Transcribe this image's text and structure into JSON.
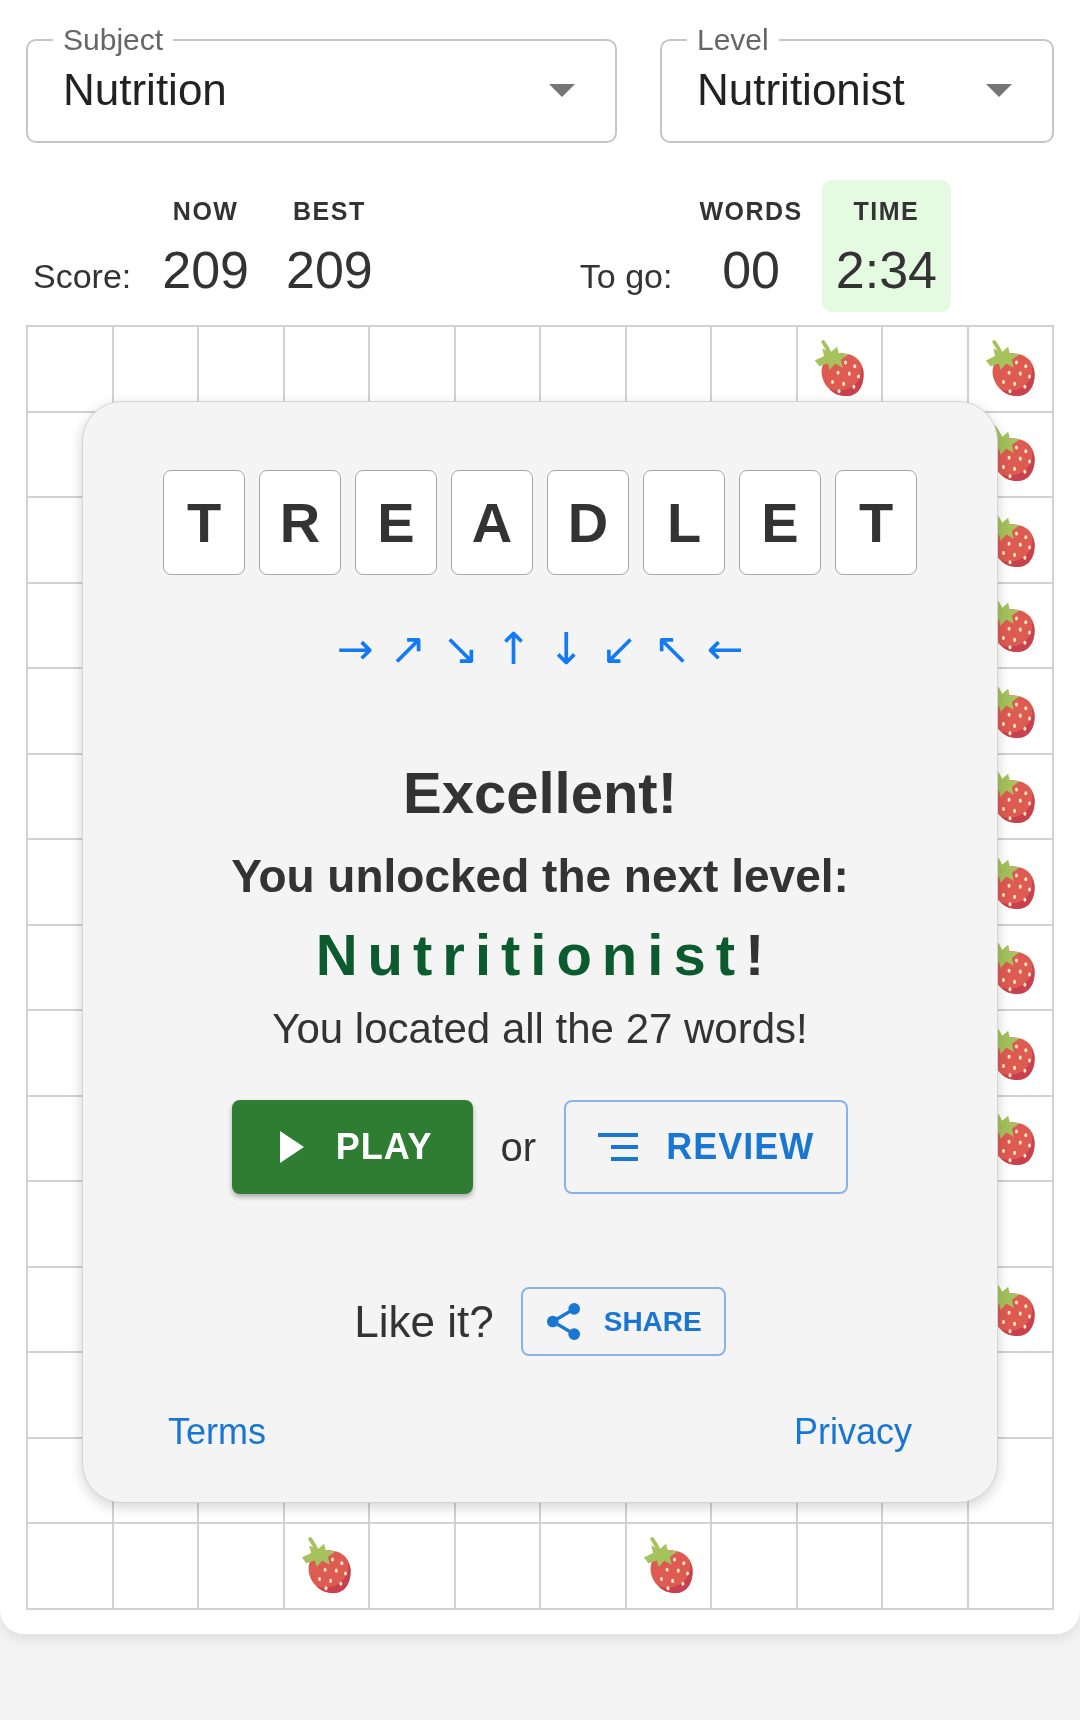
{
  "selects": [
    {
      "label": "Subject",
      "value": "Nutrition"
    },
    {
      "label": "Level",
      "value": "Nutritionist"
    }
  ],
  "score": {
    "label": "Score:",
    "stats": [
      {
        "label": "NOW",
        "value": "209",
        "highlighted": false
      },
      {
        "label": "BEST",
        "value": "209",
        "highlighted": false
      }
    ]
  },
  "to_go": {
    "label": "To go:",
    "stats": [
      {
        "label": "WORDS",
        "value": "00",
        "highlighted": false
      },
      {
        "label": "TIME",
        "value": "2:34",
        "highlighted": true
      }
    ]
  },
  "grid": {
    "rows": [
      {
        "cells": [
          {
            "kind": "blank"
          },
          {
            "kind": "blank"
          },
          {
            "kind": "blank"
          },
          {
            "kind": "blank"
          },
          {
            "kind": "blank"
          },
          {
            "kind": "blank"
          },
          {
            "kind": "blank"
          },
          {
            "kind": "blank"
          },
          {
            "kind": "blank"
          },
          {
            "kind": "strawberry"
          },
          {
            "kind": "blank"
          },
          {
            "kind": "strawberry"
          }
        ]
      },
      {
        "cells": [
          {
            "kind": "blank"
          },
          {
            "kind": "strawberry"
          }
        ]
      },
      {
        "cells": [
          {
            "kind": "blank"
          },
          {
            "kind": "strawberry"
          }
        ]
      },
      {
        "cells": [
          {
            "kind": "blank"
          },
          {
            "kind": "strawberry"
          }
        ]
      },
      {
        "cells": [
          {
            "kind": "blank"
          },
          {
            "kind": "strawberry"
          }
        ]
      },
      {
        "cells": [
          {
            "kind": "blank"
          },
          {
            "kind": "strawberry"
          }
        ]
      },
      {
        "cells": [
          {
            "kind": "blank"
          },
          {
            "kind": "strawberry"
          }
        ]
      },
      {
        "cells": [
          {
            "kind": "blank"
          },
          {
            "kind": "strawberry"
          }
        ]
      },
      {
        "cells": [
          {
            "kind": "blank"
          },
          {
            "kind": "strawberry"
          }
        ]
      },
      {
        "cells": [
          {
            "kind": "blank"
          },
          {
            "kind": "strawberry"
          }
        ]
      },
      {
        "cells": [
          {
            "kind": "blank"
          },
          {
            "kind": "blank"
          }
        ]
      },
      {
        "cells": [
          {
            "kind": "blank"
          },
          {
            "kind": "strawberry"
          }
        ]
      },
      {
        "cells": [
          {
            "kind": "blank"
          },
          {
            "kind": "blank"
          }
        ]
      },
      {
        "cells": [
          {
            "kind": "blank"
          },
          {
            "kind": "blank"
          },
          {
            "kind": "blank"
          },
          {
            "kind": "blank"
          },
          {
            "kind": "blank"
          },
          {
            "kind": "blank"
          },
          {
            "kind": "blank"
          },
          {
            "kind": "blank"
          },
          {
            "kind": "blank"
          },
          {
            "kind": "blank"
          },
          {
            "kind": "blank"
          },
          {
            "kind": "blank"
          }
        ]
      },
      {
        "cells": [
          {
            "kind": "blank"
          },
          {
            "kind": "blank"
          },
          {
            "kind": "blank"
          },
          {
            "kind": "strawberry"
          },
          {
            "kind": "blank"
          },
          {
            "kind": "blank"
          },
          {
            "kind": "blank"
          },
          {
            "kind": "strawberry"
          },
          {
            "kind": "blank"
          },
          {
            "kind": "blank"
          },
          {
            "kind": "blank"
          },
          {
            "kind": "blank"
          }
        ]
      }
    ]
  },
  "dialog": {
    "letters": [
      "T",
      "R",
      "E",
      "A",
      "D",
      "L",
      "E",
      "T"
    ],
    "directions": [
      "→",
      "↗",
      "↘",
      "↑",
      "↓",
      "↙",
      "↖",
      "←"
    ],
    "title": "Excellent!",
    "subtitle": "You unlocked the next level:",
    "level_name": "Nutritionist",
    "level_suffix": "!",
    "message": "You located all the 27 words!",
    "buttons": [
      {
        "kind": "primary",
        "label": "PLAY"
      },
      {
        "kind": "outlined",
        "label": "REVIEW"
      }
    ],
    "separator": "or",
    "share": {
      "prompt": "Like it?",
      "button": "SHARE"
    },
    "links": [
      "Terms",
      "Privacy"
    ]
  }
}
